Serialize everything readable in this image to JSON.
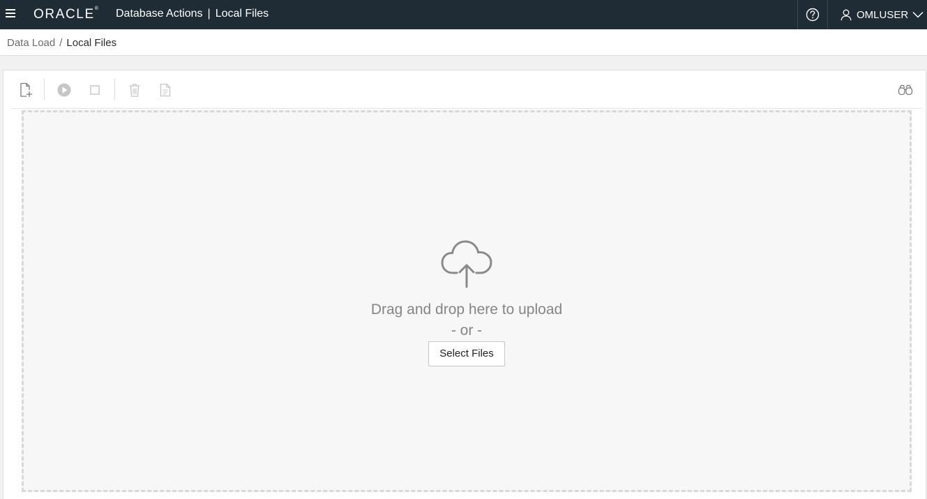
{
  "header": {
    "menu_icon": "hamburger-icon",
    "brand": "ORACLE",
    "brand_mark": "®",
    "app_name": "Database Actions",
    "separator": "|",
    "page_name": "Local Files",
    "help_icon": "help-circle-icon",
    "user_icon": "user-icon",
    "user_name": "OMLUSER",
    "user_menu_icon": "chevron-down-icon"
  },
  "breadcrumb": {
    "parent": "Data Load",
    "separator": "/",
    "current": "Local Files"
  },
  "toolbar": {
    "buttons": [
      {
        "icon": "add-file-icon",
        "enabled": true
      },
      {
        "icon": "play-icon",
        "enabled": false
      },
      {
        "icon": "stop-icon",
        "enabled": false
      },
      {
        "icon": "trash-icon",
        "enabled": false
      },
      {
        "icon": "document-icon",
        "enabled": false
      }
    ],
    "right_icon": "binoculars-icon"
  },
  "dropzone": {
    "icon": "cloud-upload-icon",
    "message": "Drag and drop here to upload",
    "or_text": "- or -",
    "button_label": "Select Files"
  },
  "colors": {
    "header_bg": "#1f2b35",
    "header_text": "#ffffff",
    "disabled_icon": "#c6c6c6",
    "enabled_icon": "#7a7a7a",
    "dropzone_text": "#858585"
  }
}
